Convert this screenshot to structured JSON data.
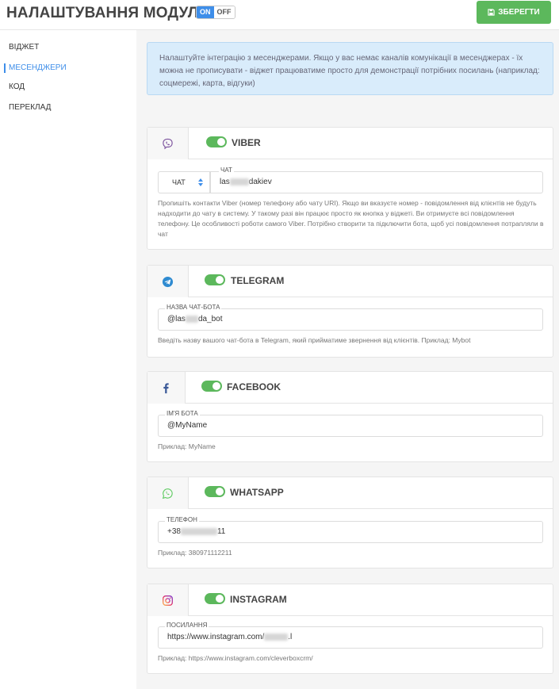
{
  "header": {
    "title": "НАЛАШТУВАННЯ МОДУЛЯ",
    "toggle_on": "ON",
    "toggle_off": "OFF",
    "save_label": "ЗБЕРЕГТИ"
  },
  "sidebar": {
    "items": [
      {
        "label": "ВІДЖЕТ",
        "active": false
      },
      {
        "label": "МЕСЕНДЖЕРИ",
        "active": true
      },
      {
        "label": "КОД",
        "active": false
      },
      {
        "label": "ПЕРЕКЛАД",
        "active": false
      }
    ]
  },
  "info": {
    "text": "Налаштуйте інтеграцію з месенджерами. Якщо у вас немає каналів комунікації в месенджерах - їх можна не прописувати - віджет працюватиме просто для демонстрації потрібних посилань (наприклад: соцмережі, карта, відгуки)"
  },
  "viber": {
    "title": "VIBER",
    "enabled": true,
    "select_value": "ЧАТ",
    "field_label": "ЧАТ",
    "value_start": "las",
    "value_end": "dakiev",
    "help": "Пропишіть контакти Viber (номер телефону або чату URI). Якщо ви вказуєте номер - повідомлення від клієнтів не будуть надходити до чату в систему. У такому разі він працює просто як кнопка у віджеті. Ви отримуєте всі повідомлення телефону. Це особливості роботи самого Viber. Потрібно створити та підключити бота, щоб усі повідомлення потрапляли в чат"
  },
  "telegram": {
    "title": "TELEGRAM",
    "enabled": true,
    "field_label": "НАЗВА ЧАТ-БОТА",
    "value_start": "@las",
    "value_end": "da_bot",
    "help": "Введіть назву вашого чат-бота в Telegram, який прийматиме звернення від клієнтів. Приклад: Mybot"
  },
  "facebook": {
    "title": "FACEBOOK",
    "enabled": true,
    "field_label": "ІМ'Я БОТА",
    "value": "@MyName",
    "help": "Приклад: MyName"
  },
  "whatsapp": {
    "title": "WHATSAPP",
    "enabled": true,
    "field_label": "ТЕЛЕФОН",
    "value_start": "+38",
    "value_end": "11",
    "help": "Приклад: 380971112211"
  },
  "instagram": {
    "title": "INSTAGRAM",
    "enabled": true,
    "field_label": "ПОСИЛАННЯ",
    "value_start": "https://www.instagram.com/",
    "value_end": ".l",
    "help": "Приклад: https://www.instagram.com/cleverboxcrm/"
  },
  "colors": {
    "accent": "#3e8ee9",
    "success": "#5cb85c",
    "viber": "#7b519d",
    "telegram": "#2f8bd1",
    "facebook": "#3b5998",
    "whatsapp": "#5fcb62",
    "instagram": "#d6249f"
  }
}
